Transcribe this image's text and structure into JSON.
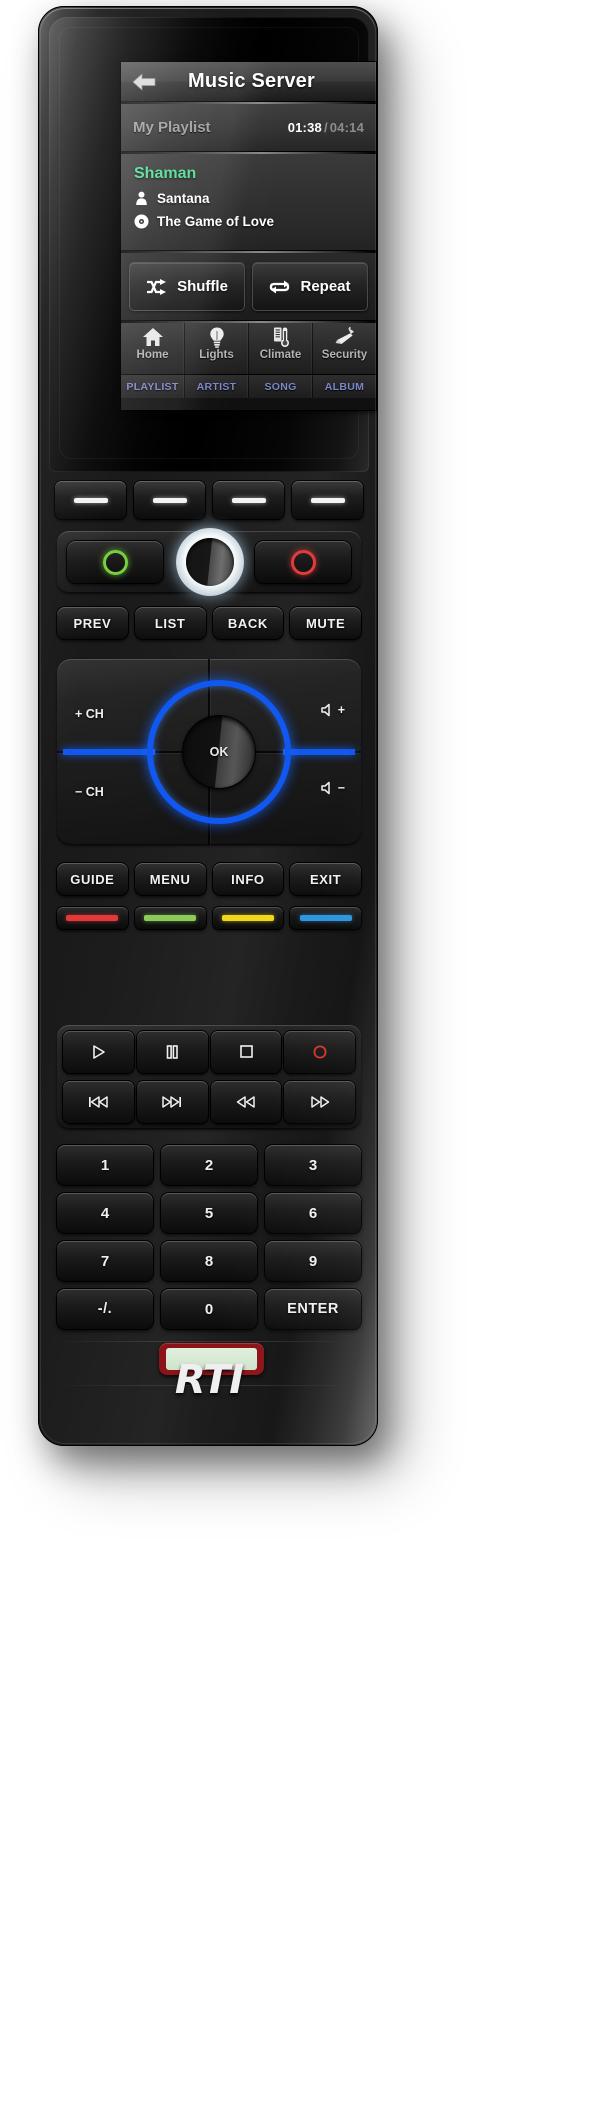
{
  "device": {
    "brand_logo": "RTI",
    "ir_window_name": "ir-emitter-window"
  },
  "screen": {
    "header": {
      "back_icon": "back-arrow-icon",
      "title": "Music Server"
    },
    "now_playing": {
      "source_label": "My Playlist",
      "elapsed": "01:38",
      "separator": "/",
      "total": "04:14"
    },
    "track": {
      "album": "Shaman",
      "artist_icon": "artist-icon",
      "artist": "Santana",
      "song_icon": "disc-icon",
      "song": "The Game of Love"
    },
    "controls": [
      {
        "icon": "shuffle-icon",
        "label": "Shuffle"
      },
      {
        "icon": "repeat-icon",
        "label": "Repeat"
      }
    ],
    "nav": [
      {
        "icon": "home-icon",
        "label": "Home"
      },
      {
        "icon": "lightbulb-icon",
        "label": "Lights"
      },
      {
        "icon": "thermometer-icon",
        "label": "Climate"
      },
      {
        "icon": "camera-icon",
        "label": "Security"
      }
    ],
    "tabs": [
      {
        "label": "PLAYLIST"
      },
      {
        "label": "ARTIST"
      },
      {
        "label": "SONG"
      },
      {
        "label": "ALBUM"
      }
    ],
    "colors": {
      "album_green": "#4ddc95",
      "tab_blue": "#7b87c8",
      "nav_gray": "#b3b3b3"
    }
  },
  "keypad": {
    "softkeys": [
      {
        "name": "soft-key-1"
      },
      {
        "name": "soft-key-2"
      },
      {
        "name": "soft-key-3"
      },
      {
        "name": "soft-key-4"
      }
    ],
    "power": {
      "on_icon": "power-on-ring-icon",
      "on_color": "#76cf3c",
      "off_icon": "power-off-ring-icon",
      "off_color": "#e23b3b",
      "jog_name": "jog-wheel"
    },
    "nav_keys": [
      {
        "label": "PREV"
      },
      {
        "label": "LIST"
      },
      {
        "label": "BACK"
      },
      {
        "label": "MUTE"
      }
    ],
    "dpad": {
      "up_label": "+ CH",
      "down_label": "− CH",
      "vol_up_label": "+",
      "vol_down_label": "−",
      "ok_label": "OK",
      "ring_color": "#1158f0"
    },
    "menu_keys": [
      {
        "label": "GUIDE"
      },
      {
        "label": "MENU"
      },
      {
        "label": "INFO"
      },
      {
        "label": "EXIT"
      }
    ],
    "color_keys": [
      {
        "name": "red-color-key",
        "color": "#e23a3a"
      },
      {
        "name": "green-color-key",
        "color": "#8ccb5a"
      },
      {
        "name": "yellow-color-key",
        "color": "#f2d718"
      },
      {
        "name": "blue-color-key",
        "color": "#2e95de"
      }
    ],
    "transport_row1": [
      {
        "name": "play-button",
        "icon": "play-icon"
      },
      {
        "name": "pause-button",
        "icon": "pause-icon"
      },
      {
        "name": "stop-button",
        "icon": "stop-icon"
      },
      {
        "name": "record-button",
        "icon": "record-icon"
      }
    ],
    "transport_row2": [
      {
        "name": "previous-track-button",
        "icon": "skip-back-icon"
      },
      {
        "name": "next-track-button",
        "icon": "skip-forward-icon"
      },
      {
        "name": "rewind-button",
        "icon": "rewind-icon"
      },
      {
        "name": "fast-forward-button",
        "icon": "fast-forward-icon"
      }
    ],
    "numbers": [
      [
        {
          "label": "1"
        },
        {
          "label": "2"
        },
        {
          "label": "3"
        }
      ],
      [
        {
          "label": "4"
        },
        {
          "label": "5"
        },
        {
          "label": "6"
        }
      ],
      [
        {
          "label": "7"
        },
        {
          "label": "8"
        },
        {
          "label": "9"
        }
      ],
      [
        {
          "label": "-/."
        },
        {
          "label": "0"
        },
        {
          "label": "ENTER"
        }
      ]
    ]
  }
}
